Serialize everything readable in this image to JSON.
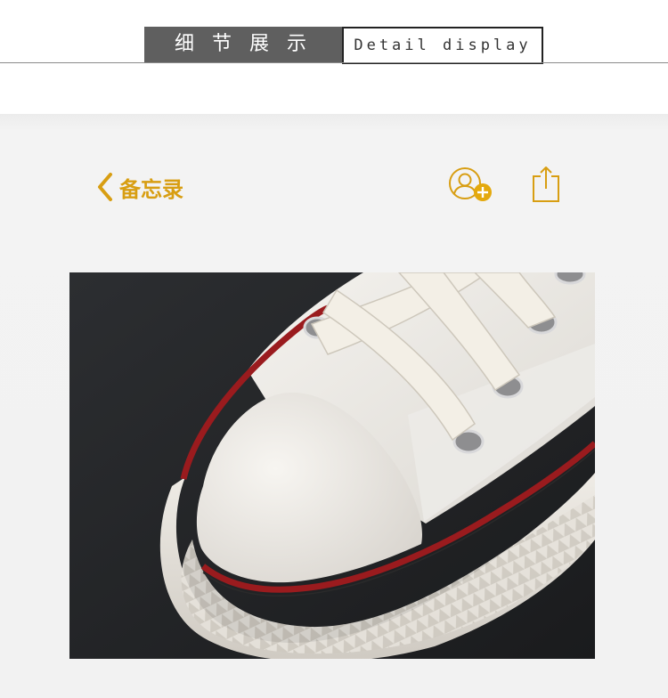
{
  "header": {
    "title_cn": "细节展示",
    "title_en": "Detail display"
  },
  "nav": {
    "back_label": "备忘录",
    "accent_color": "#d89e12",
    "back_icon": "chevron-left-icon",
    "add_contact_icon": "add-contact-icon",
    "share_icon": "share-icon"
  },
  "photo": {
    "subject": "shoe-toe-closeup"
  }
}
